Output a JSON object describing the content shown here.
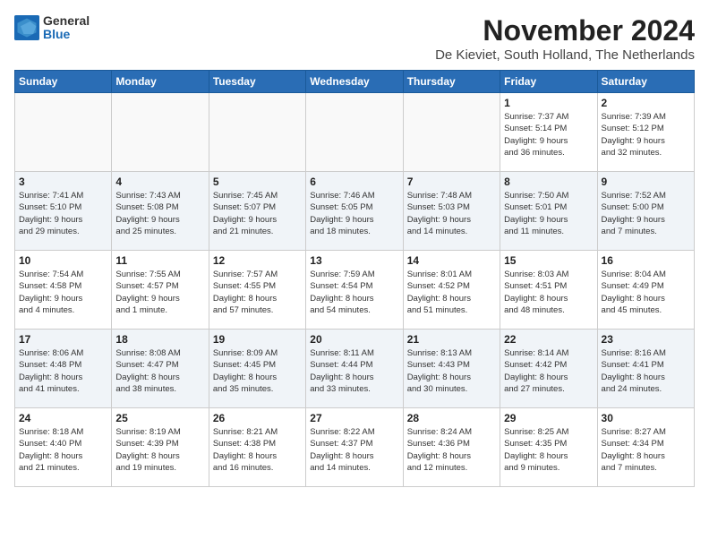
{
  "header": {
    "logo_general": "General",
    "logo_blue": "Blue",
    "month_title": "November 2024",
    "location": "De Kieviet, South Holland, The Netherlands"
  },
  "weekdays": [
    "Sunday",
    "Monday",
    "Tuesday",
    "Wednesday",
    "Thursday",
    "Friday",
    "Saturday"
  ],
  "weeks": [
    [
      {
        "day": "",
        "info": ""
      },
      {
        "day": "",
        "info": ""
      },
      {
        "day": "",
        "info": ""
      },
      {
        "day": "",
        "info": ""
      },
      {
        "day": "",
        "info": ""
      },
      {
        "day": "1",
        "info": "Sunrise: 7:37 AM\nSunset: 5:14 PM\nDaylight: 9 hours\nand 36 minutes."
      },
      {
        "day": "2",
        "info": "Sunrise: 7:39 AM\nSunset: 5:12 PM\nDaylight: 9 hours\nand 32 minutes."
      }
    ],
    [
      {
        "day": "3",
        "info": "Sunrise: 7:41 AM\nSunset: 5:10 PM\nDaylight: 9 hours\nand 29 minutes."
      },
      {
        "day": "4",
        "info": "Sunrise: 7:43 AM\nSunset: 5:08 PM\nDaylight: 9 hours\nand 25 minutes."
      },
      {
        "day": "5",
        "info": "Sunrise: 7:45 AM\nSunset: 5:07 PM\nDaylight: 9 hours\nand 21 minutes."
      },
      {
        "day": "6",
        "info": "Sunrise: 7:46 AM\nSunset: 5:05 PM\nDaylight: 9 hours\nand 18 minutes."
      },
      {
        "day": "7",
        "info": "Sunrise: 7:48 AM\nSunset: 5:03 PM\nDaylight: 9 hours\nand 14 minutes."
      },
      {
        "day": "8",
        "info": "Sunrise: 7:50 AM\nSunset: 5:01 PM\nDaylight: 9 hours\nand 11 minutes."
      },
      {
        "day": "9",
        "info": "Sunrise: 7:52 AM\nSunset: 5:00 PM\nDaylight: 9 hours\nand 7 minutes."
      }
    ],
    [
      {
        "day": "10",
        "info": "Sunrise: 7:54 AM\nSunset: 4:58 PM\nDaylight: 9 hours\nand 4 minutes."
      },
      {
        "day": "11",
        "info": "Sunrise: 7:55 AM\nSunset: 4:57 PM\nDaylight: 9 hours\nand 1 minute."
      },
      {
        "day": "12",
        "info": "Sunrise: 7:57 AM\nSunset: 4:55 PM\nDaylight: 8 hours\nand 57 minutes."
      },
      {
        "day": "13",
        "info": "Sunrise: 7:59 AM\nSunset: 4:54 PM\nDaylight: 8 hours\nand 54 minutes."
      },
      {
        "day": "14",
        "info": "Sunrise: 8:01 AM\nSunset: 4:52 PM\nDaylight: 8 hours\nand 51 minutes."
      },
      {
        "day": "15",
        "info": "Sunrise: 8:03 AM\nSunset: 4:51 PM\nDaylight: 8 hours\nand 48 minutes."
      },
      {
        "day": "16",
        "info": "Sunrise: 8:04 AM\nSunset: 4:49 PM\nDaylight: 8 hours\nand 45 minutes."
      }
    ],
    [
      {
        "day": "17",
        "info": "Sunrise: 8:06 AM\nSunset: 4:48 PM\nDaylight: 8 hours\nand 41 minutes."
      },
      {
        "day": "18",
        "info": "Sunrise: 8:08 AM\nSunset: 4:47 PM\nDaylight: 8 hours\nand 38 minutes."
      },
      {
        "day": "19",
        "info": "Sunrise: 8:09 AM\nSunset: 4:45 PM\nDaylight: 8 hours\nand 35 minutes."
      },
      {
        "day": "20",
        "info": "Sunrise: 8:11 AM\nSunset: 4:44 PM\nDaylight: 8 hours\nand 33 minutes."
      },
      {
        "day": "21",
        "info": "Sunrise: 8:13 AM\nSunset: 4:43 PM\nDaylight: 8 hours\nand 30 minutes."
      },
      {
        "day": "22",
        "info": "Sunrise: 8:14 AM\nSunset: 4:42 PM\nDaylight: 8 hours\nand 27 minutes."
      },
      {
        "day": "23",
        "info": "Sunrise: 8:16 AM\nSunset: 4:41 PM\nDaylight: 8 hours\nand 24 minutes."
      }
    ],
    [
      {
        "day": "24",
        "info": "Sunrise: 8:18 AM\nSunset: 4:40 PM\nDaylight: 8 hours\nand 21 minutes."
      },
      {
        "day": "25",
        "info": "Sunrise: 8:19 AM\nSunset: 4:39 PM\nDaylight: 8 hours\nand 19 minutes."
      },
      {
        "day": "26",
        "info": "Sunrise: 8:21 AM\nSunset: 4:38 PM\nDaylight: 8 hours\nand 16 minutes."
      },
      {
        "day": "27",
        "info": "Sunrise: 8:22 AM\nSunset: 4:37 PM\nDaylight: 8 hours\nand 14 minutes."
      },
      {
        "day": "28",
        "info": "Sunrise: 8:24 AM\nSunset: 4:36 PM\nDaylight: 8 hours\nand 12 minutes."
      },
      {
        "day": "29",
        "info": "Sunrise: 8:25 AM\nSunset: 4:35 PM\nDaylight: 8 hours\nand 9 minutes."
      },
      {
        "day": "30",
        "info": "Sunrise: 8:27 AM\nSunset: 4:34 PM\nDaylight: 8 hours\nand 7 minutes."
      }
    ]
  ]
}
